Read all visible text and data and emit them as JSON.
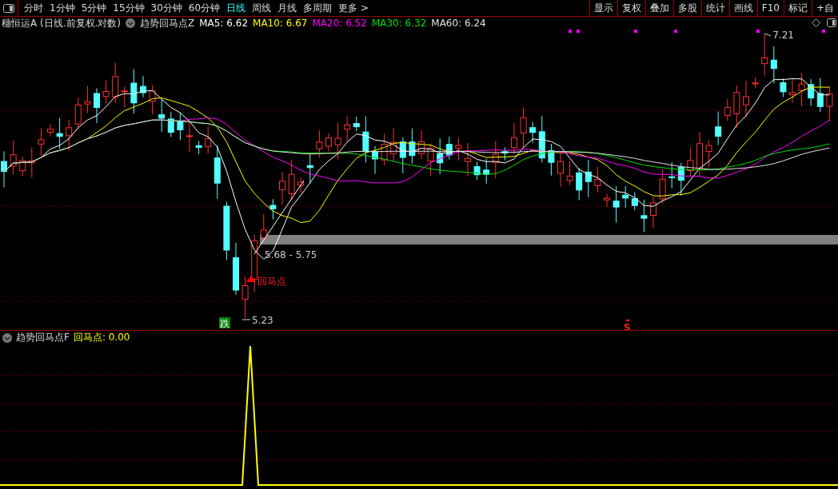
{
  "toolbar": {
    "tabs": [
      {
        "label": "分时",
        "selected": false
      },
      {
        "label": "1分钟",
        "selected": false
      },
      {
        "label": "5分钟",
        "selected": false
      },
      {
        "label": "15分钟",
        "selected": false
      },
      {
        "label": "30分钟",
        "selected": false
      },
      {
        "label": "60分钟",
        "selected": false
      },
      {
        "label": "日线",
        "selected": true
      },
      {
        "label": "周线",
        "selected": false
      },
      {
        "label": "月线",
        "selected": false
      },
      {
        "label": "多周期",
        "selected": false
      },
      {
        "label": "更多 >",
        "selected": false
      }
    ],
    "buttons": [
      "显示",
      "复权",
      "叠加",
      "多股",
      "统计",
      "画线",
      "F10",
      "标记",
      "+自"
    ]
  },
  "chart": {
    "title": "穗恒运A (日线.前复权.对数)",
    "indicator": "趋势回马点Z",
    "ma": [
      {
        "label": "MA5: 6.62",
        "color": "#ffffff"
      },
      {
        "label": "MA10: 6.67",
        "color": "#ffff00"
      },
      {
        "label": "MA20: 6.52",
        "color": "#ff00ff"
      },
      {
        "label": "MA30: 6.32",
        "color": "#00e000"
      },
      {
        "label": "MA60: 6.24",
        "color": "#e0e0e0"
      }
    ],
    "high_label": "7.21",
    "range_label": "5.68 - 5.75",
    "signal_label": "回马点",
    "low_label": "5.23",
    "fall_badge": "跌",
    "sell_mark": "S"
  },
  "sub_chart": {
    "indicator": "趋势回马点F",
    "value_label": "回马点: 0.00"
  }
}
